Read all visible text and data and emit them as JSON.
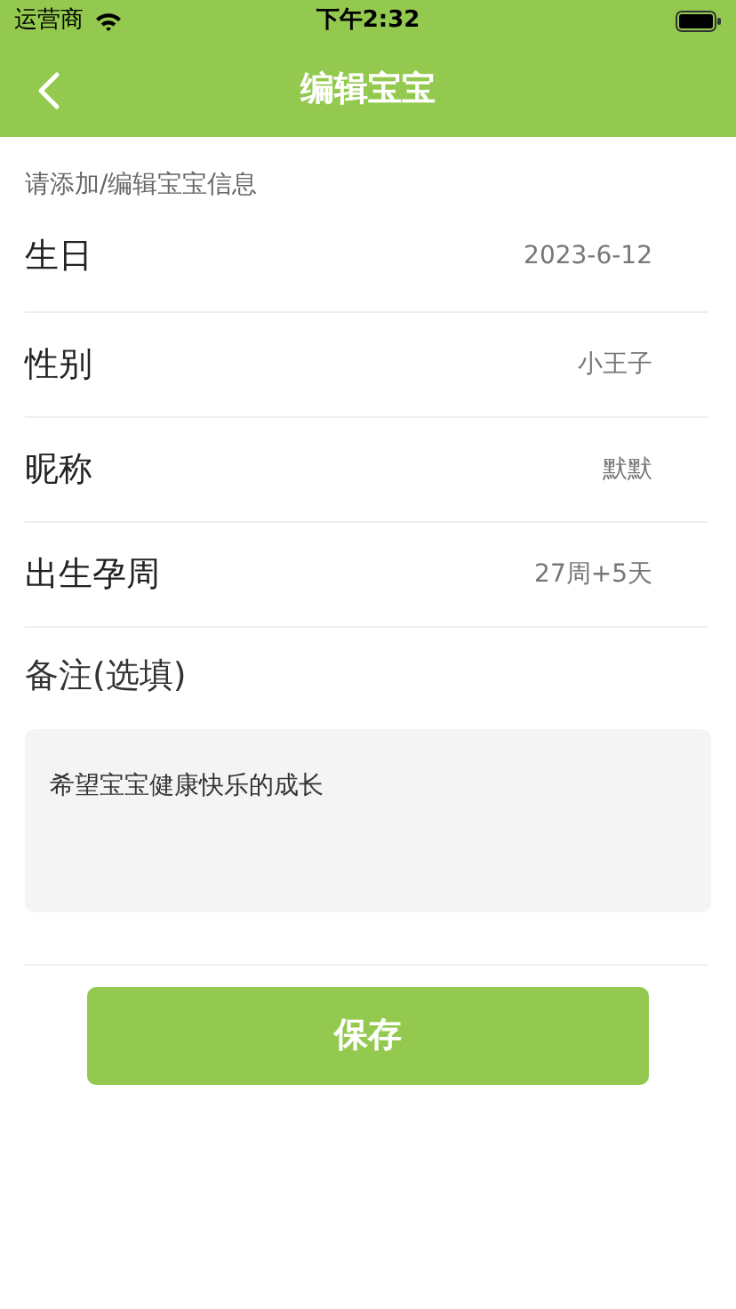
{
  "status_bar": {
    "carrier": "运营商",
    "time": "下午2:32"
  },
  "nav": {
    "title": "编辑宝宝"
  },
  "hint": "请添加/编辑宝宝信息",
  "fields": [
    {
      "label": "生日",
      "value": "2023-6-12"
    },
    {
      "label": "性别",
      "value": "小王子"
    },
    {
      "label": "昵称",
      "value": "默默"
    },
    {
      "label": "出生孕周",
      "value": "27周+5天"
    }
  ],
  "note": {
    "label": "备注(选填)",
    "value": "希望宝宝健康快乐的成长"
  },
  "save_button": "保存"
}
